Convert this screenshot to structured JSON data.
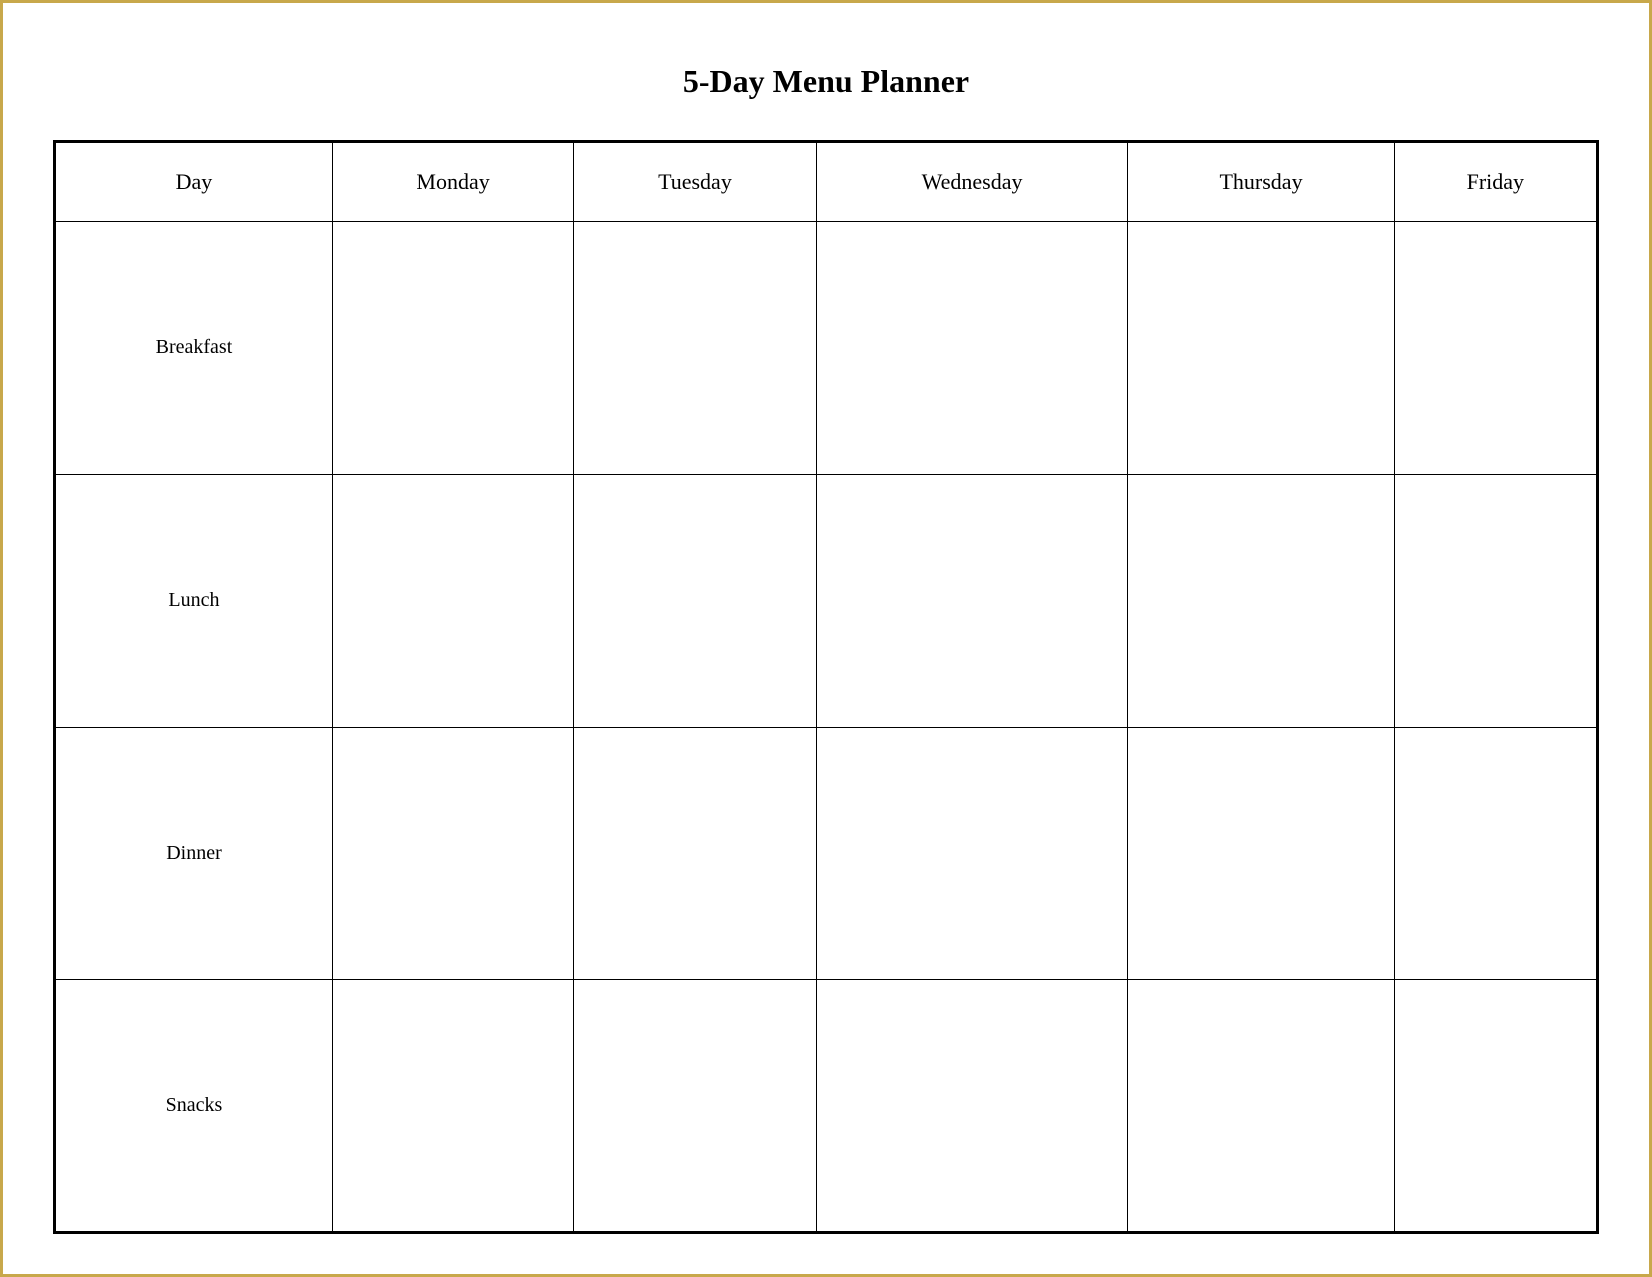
{
  "title": "5-Day Menu Planner",
  "columns": {
    "day": "Day",
    "monday": "Monday",
    "tuesday": "Tuesday",
    "wednesday": "Wednesday",
    "thursday": "Thursday",
    "friday": "Friday"
  },
  "rows": [
    {
      "label": "Breakfast"
    },
    {
      "label": "Lunch"
    },
    {
      "label": "Dinner"
    },
    {
      "label": "Snacks"
    }
  ]
}
